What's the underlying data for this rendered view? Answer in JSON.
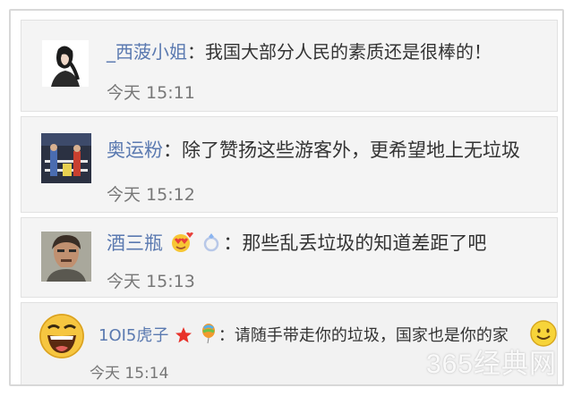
{
  "comments": [
    {
      "username": "_西菠小姐",
      "separator": "：",
      "text": "我国大部分人民的素质还是很棒的！",
      "time": "今天 15:11",
      "avatar_icon": "woman-profile-photo"
    },
    {
      "username": "奥运粉",
      "separator": "：",
      "text": "除了赞扬这些游客外，更希望地上无垃圾",
      "time": "今天 15:12",
      "avatar_icon": "tennis-court-photo"
    },
    {
      "username": "酒三瓶",
      "separator": "：",
      "text": "那些乱丢垃圾的知道差距了吧",
      "time": "今天 15:13",
      "avatar_icon": "man-portrait-photo",
      "badges": [
        "heart-eyes-emoji-icon",
        "ring-icon"
      ]
    },
    {
      "username": "1OI5虎子",
      "separator": "：",
      "text": "请随手带走你的垃圾，国家也是你的家",
      "time": "今天 15:14",
      "avatar_icon": "laughing-face-avatar",
      "badges": [
        "red-star-icon",
        "balloon-icon"
      ],
      "trailing_emoji": "smile-emoji-icon"
    }
  ],
  "watermark": "365经典网",
  "colors": {
    "username": "#5a79b0",
    "text": "#333333",
    "time": "#777777",
    "card_bg": "#f4f4f4"
  }
}
